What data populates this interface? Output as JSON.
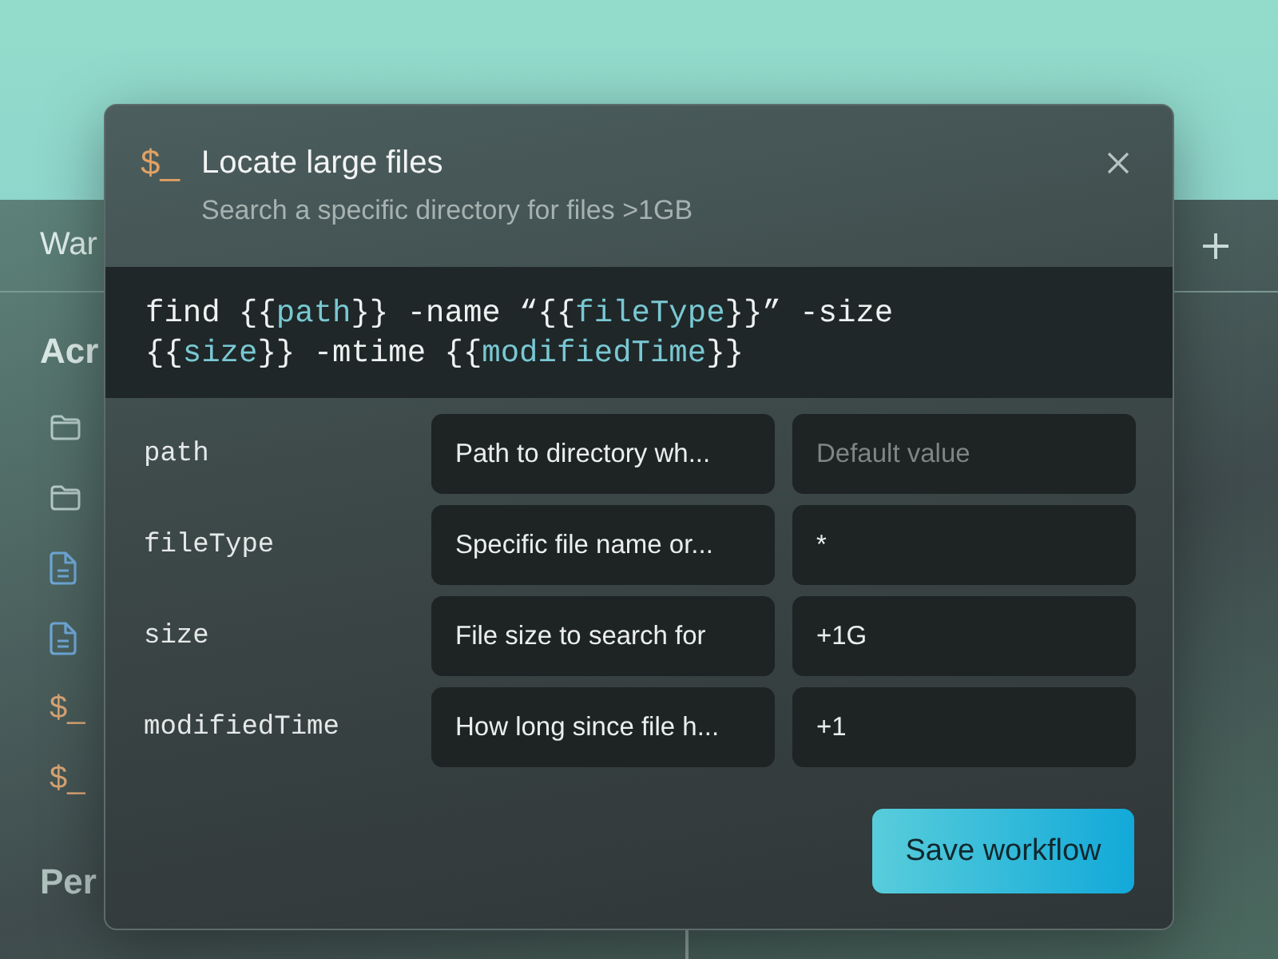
{
  "background_app": {
    "tab": "War",
    "section_1": "Acr",
    "section_2": "Per",
    "sidebar_items": [
      {
        "kind": "folder"
      },
      {
        "kind": "folder"
      },
      {
        "kind": "doc"
      },
      {
        "kind": "doc"
      },
      {
        "kind": "terminal",
        "glyph": "$_"
      },
      {
        "kind": "terminal",
        "glyph": "$_"
      }
    ]
  },
  "dialog": {
    "icon": "$_",
    "title": "Locate large files",
    "subtitle": "Search a specific directory for files >1GB",
    "command_lines": [
      [
        {
          "kind": "plain",
          "text": "find {{"
        },
        {
          "kind": "var",
          "text": "path"
        },
        {
          "kind": "plain",
          "text": "}} -name “{{"
        },
        {
          "kind": "var",
          "text": "fileType"
        },
        {
          "kind": "plain",
          "text": "}}” -size"
        }
      ],
      [
        {
          "kind": "plain",
          "text": "{{"
        },
        {
          "kind": "var",
          "text": "size"
        },
        {
          "kind": "plain",
          "text": "}} -mtime {{"
        },
        {
          "kind": "var",
          "text": "modifiedTime"
        },
        {
          "kind": "plain",
          "text": "}}"
        }
      ]
    ],
    "parameters": [
      {
        "name": "path",
        "description": "Path to directory wh...",
        "default": {
          "placeholder": "Default value"
        }
      },
      {
        "name": "fileType",
        "description": "Specific file name or...",
        "default": {
          "value": "*"
        }
      },
      {
        "name": "size",
        "description": "File size to search for",
        "default": {
          "value": "+1G"
        }
      },
      {
        "name": "modifiedTime",
        "description": "How long since file h...",
        "default": {
          "value": "+1"
        }
      }
    ],
    "save_button": "Save workflow"
  }
}
